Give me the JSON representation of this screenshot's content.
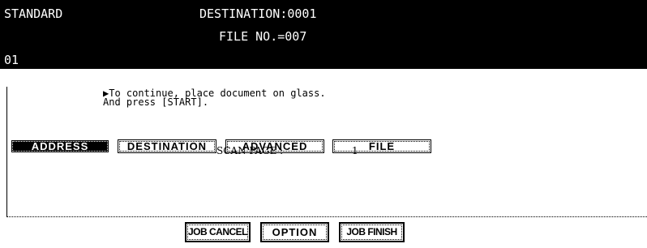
{
  "header": {
    "mode": "STANDARD",
    "destination_info": "DESTINATION:0001",
    "file_no": "FILE NO.=007",
    "counter": "01"
  },
  "tabs": [
    {
      "label": "ADDRESS",
      "active": true
    },
    {
      "label": "DESTINATION",
      "active": false
    },
    {
      "label": "ADVANCED",
      "active": false
    },
    {
      "label": "FILE",
      "active": false
    }
  ],
  "message": {
    "arrow": "▶",
    "line1": "To continue, place document on glass.",
    "line2": "And press [START]."
  },
  "scan": {
    "label": "SCAN PAGE :",
    "value": "1"
  },
  "buttons": {
    "job_cancel": "JOB CANCEL",
    "option": "OPTION",
    "job_finish": "JOB FINISH"
  },
  "colors": {
    "header_background": "#000000",
    "header_text": "#ffffff",
    "background": "#ffffff",
    "text": "#000000"
  }
}
